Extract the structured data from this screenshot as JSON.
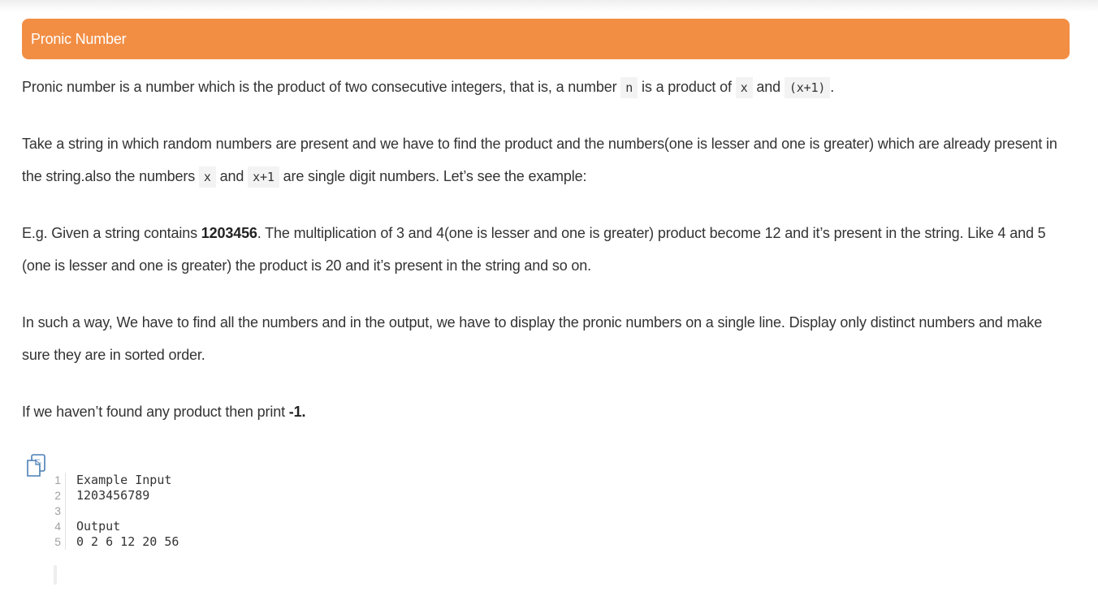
{
  "header": {
    "title": "Pronic Number"
  },
  "p1": {
    "t1": "Pronic number is a number which is the product of two consecutive integers, that is, a number ",
    "c1": "n",
    "t2": " is a product of ",
    "c2": "x",
    "t3": " and ",
    "c3": "(x+1)",
    "t4": "."
  },
  "p2": {
    "t1": "Take a string in which random numbers are present and we have to find the product and the numbers(one is lesser and one is greater) which are already present in the string.also the numbers ",
    "c1": "x",
    "t2": " and ",
    "c2": "x+1",
    "t3": " are single digit numbers. Let’s see the example:"
  },
  "p3": {
    "t1": "E.g. Given a string contains ",
    "b1": "1203456",
    "t2": ". The multiplication of 3 and 4(one is lesser and one is greater) product become 12 and it’s present in the string. Like 4 and 5 (one is lesser and one is greater) the product is 20 and it’s present in the string and so on."
  },
  "p4": {
    "text": "In such a way, We have to find all the numbers and in the output, we have to display the pronic numbers on a single line. Display only distinct numbers and make sure they are in sorted order."
  },
  "p5": {
    "t1": "If we haven’t found any product then print ",
    "b1": "-1."
  },
  "code": {
    "icon": "copy-icon",
    "lines": [
      {
        "num": "1",
        "text": "Example Input"
      },
      {
        "num": "2",
        "text": "1203456789"
      },
      {
        "num": "3",
        "text": ""
      },
      {
        "num": "4",
        "text": "Output"
      },
      {
        "num": "5",
        "text": "0 2 6 12 20 56"
      }
    ]
  },
  "colors": {
    "header_bg": "#f28e44",
    "header_text": "#ffffff",
    "code_bg": "#f3f3f3"
  }
}
